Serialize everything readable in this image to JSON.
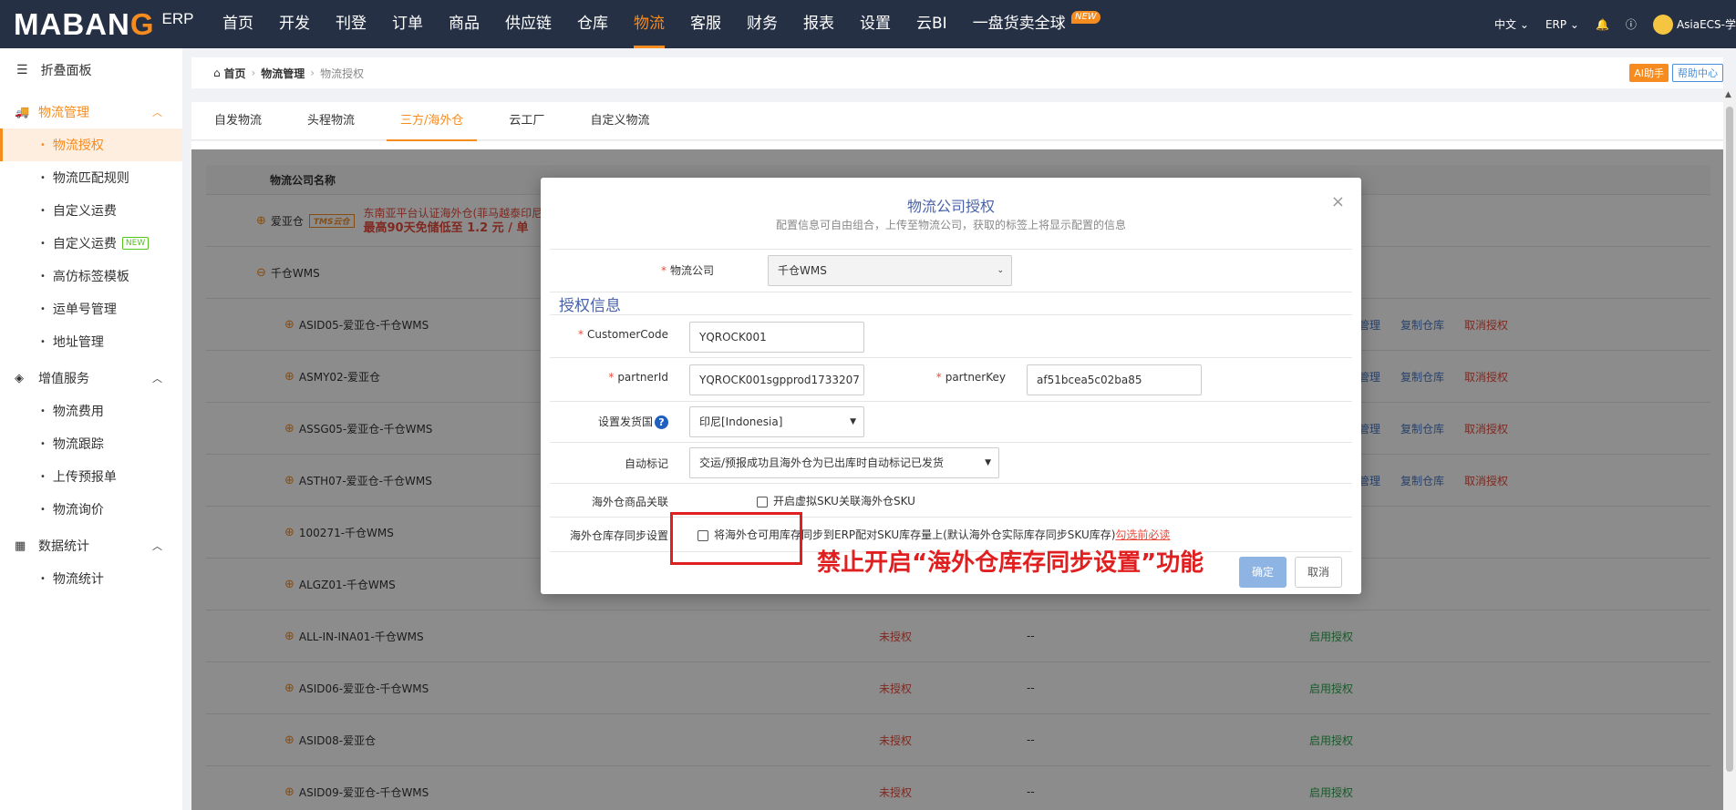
{
  "brand": {
    "logo_pre": "MABAN",
    "logo_o": "G",
    "logo_sub": "ERP"
  },
  "menu": [
    {
      "label": "首页"
    },
    {
      "label": "开发"
    },
    {
      "label": "刊登"
    },
    {
      "label": "订单"
    },
    {
      "label": "商品"
    },
    {
      "label": "供应链"
    },
    {
      "label": "仓库"
    },
    {
      "label": "物流"
    },
    {
      "label": "客服"
    },
    {
      "label": "财务"
    },
    {
      "label": "报表"
    },
    {
      "label": "设置"
    },
    {
      "label": "云BI"
    },
    {
      "label": "一盘货卖全球"
    }
  ],
  "menu_new_badge": "NEW",
  "top_right": {
    "lang": "中文",
    "erp": "ERP",
    "user": "AsiaECS-学"
  },
  "sidebar": {
    "fold": "折叠面板",
    "groups": [
      {
        "label": "物流管理",
        "items": [
          "物流授权",
          "物流匹配规则",
          "自定义运费",
          "自定义运费",
          "高仿标签模板",
          "运单号管理",
          "地址管理"
        ]
      },
      {
        "label": "增值服务",
        "items": [
          "物流费用",
          "物流跟踪",
          "上传预报单",
          "物流询价"
        ]
      },
      {
        "label": "数据统计",
        "items": [
          "物流统计"
        ]
      }
    ],
    "new_tag": "NEW"
  },
  "breadcrumb": {
    "home": "首页",
    "mid": "物流管理",
    "current": "物流授权",
    "ai": "AI助手",
    "help": "帮助中心"
  },
  "tabs": [
    "自发物流",
    "头程物流",
    "三方/海外仓",
    "云工厂",
    "自定义物流"
  ],
  "table": {
    "header_name": "物流公司名称",
    "promo_line1": "东南亚平台认证海外仓(菲马越泰印尼",
    "promo_line2": "最高90天免储低至 1.2 元 / 单",
    "tms": "TMS云仓",
    "rows": [
      {
        "name": "爱亚仓",
        "type": "group"
      },
      {
        "name": "千仓WMS",
        "type": "group-open"
      },
      {
        "name": "ASID05-爱亚仓-千仓WMS",
        "type": "auth"
      },
      {
        "name": "ASMY02-爱亚仓",
        "type": "auth"
      },
      {
        "name": "ASSG05-爱亚仓-千仓WMS",
        "type": "auth"
      },
      {
        "name": "ASTH07-爱亚仓-千仓WMS",
        "type": "auth"
      },
      {
        "name": "100271-千仓WMS",
        "type": "plain"
      },
      {
        "name": "ALGZ01-千仓WMS",
        "type": "plain"
      },
      {
        "name": "ALL-IN-INA01-千仓WMS",
        "type": "unauth"
      },
      {
        "name": "ASID06-爱亚仓-千仓WMS",
        "type": "unauth"
      },
      {
        "name": "ASID08-爱亚仓",
        "type": "unauth"
      },
      {
        "name": "ASID09-爱亚仓-千仓WMS",
        "type": "unauth"
      }
    ],
    "status_unauth": "未授权",
    "date_empty": "--",
    "enable": "启用授权",
    "act_goods": "商品管理",
    "act_copy": "复制仓库",
    "act_cancel": "取消授权"
  },
  "modal": {
    "title": "物流公司授权",
    "subtitle": "配置信息可自由组合，上传至物流公司，获取的标签上将显示配置的信息",
    "company_label": "物流公司",
    "company_value": "千仓WMS",
    "section": "授权信息",
    "customer_code_label": "CustomerCode",
    "customer_code_value": "YQROCK001",
    "partner_id_label": "partnerId",
    "partner_id_value": "YQROCK001sgpprod1733207",
    "partner_key_label": "partnerKey",
    "partner_key_value": "af51bcea5c02ba85",
    "ship_country_label": "设置发货国",
    "ship_country_value": "印尼[Indonesia]",
    "auto_mark_label": "自动标记",
    "auto_mark_value": "交运/预报成功且海外仓为已出库时自动标记已发货",
    "sku_link_label": "海外仓商品关联",
    "sku_link_text": "开启虚拟SKU关联海外仓SKU",
    "sync_label": "海外仓库存同步设置",
    "sync_text": "将海外仓可用库存同步到ERP配对SKU库存量上(默认海外仓实际库存同步SKU库存)",
    "sync_link": "勾选前必读",
    "ok": "确定",
    "cancel": "取消"
  },
  "annotation": "禁止开启“海外仓库存同步设置”功能"
}
